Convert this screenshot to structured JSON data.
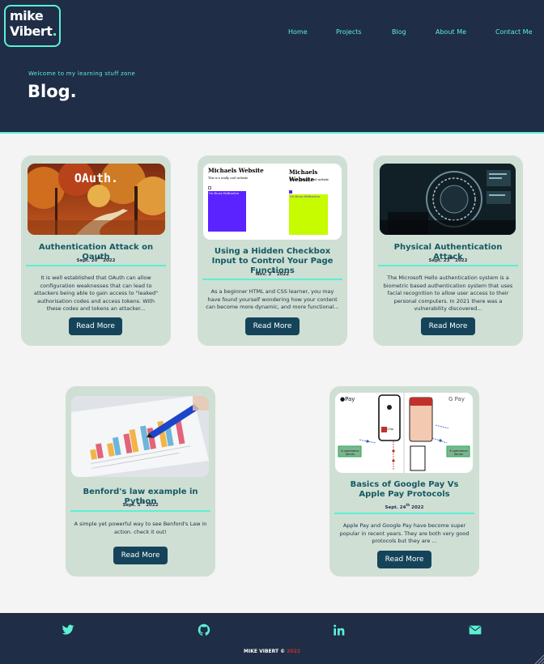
{
  "logo": {
    "line1": "mike",
    "line2": "Vibert",
    "dot": "."
  },
  "nav": [
    "Home",
    "Projects",
    "Blog",
    "About Me",
    "Contact Me"
  ],
  "hero": {
    "welcome": "Welcome to my learning stuff zone",
    "title": "Blog."
  },
  "cards": [
    {
      "title": "Authentication Attack on Oauth",
      "date_day": "Sept. 20",
      "date_sup": "th",
      "date_year": " 2022",
      "excerpt": "It is well established that OAuth can allow configuration weaknesses that can lead to attackers being able to gain access to \"leaked\" authorisation codes and access tokens. With these codes and tokens an attacker...",
      "button": "Read More",
      "thumb_text": "OAuth."
    },
    {
      "title": "Using a Hidden Checkbox Input to Control Your Page Functions",
      "date_day": "Nov. 3",
      "date_sup": "rd",
      "date_year": " 2022",
      "excerpt": "As a beginner HTML and CSS learner, you may have found yourself wondering how your content can become more dynamic, and more functional...",
      "button": "Read More",
      "thumb_heading": "Michaels Website",
      "thumb_sub": "This is a really cool website",
      "thumb_box": "I'm Bruce McBrocline"
    },
    {
      "title": "Physical Authentication Attack",
      "date_day": "Sept. 23",
      "date_sup": "th",
      "date_year": " 2022",
      "excerpt": "The Microsoft Hello authentication system is a biometric based authentication system that uses facial recognition to allow user access to their personal computers. In 2021 there was a vulnerability discovered...",
      "button": "Read More"
    },
    {
      "title": "Benford's law example in Python",
      "date_day": "Sept. 5",
      "date_sup": "th",
      "date_year": " 2022",
      "excerpt": "A simple yet powerful way to see Benford's Law in action. check it out!",
      "button": "Read More"
    },
    {
      "title": "Basics of Google Pay Vs Apple Pay Protocols",
      "date_day": "Sept. 24",
      "date_sup": "th",
      "date_year": " 2022",
      "excerpt": "Apple Pay and Google Pay have become super popular in recent years. They are both very good protocols but they are ...",
      "button": "Read More",
      "thumb_left": "Pay",
      "thumb_right": "G Pay",
      "thumb_server": "E-commerce Server",
      "thumb_chip": "Chip"
    }
  ],
  "footer": {
    "icons": [
      "twitter-icon",
      "github-icon",
      "linkedin-icon",
      "email-icon"
    ],
    "copyright_name": "MIKE VIBERT © ",
    "copyright_year": "2022"
  },
  "colors": {
    "navy": "#1f2d46",
    "accent": "#5bf0d3",
    "card": "#cfdfd4",
    "title": "#155a62",
    "button": "#15445a"
  }
}
